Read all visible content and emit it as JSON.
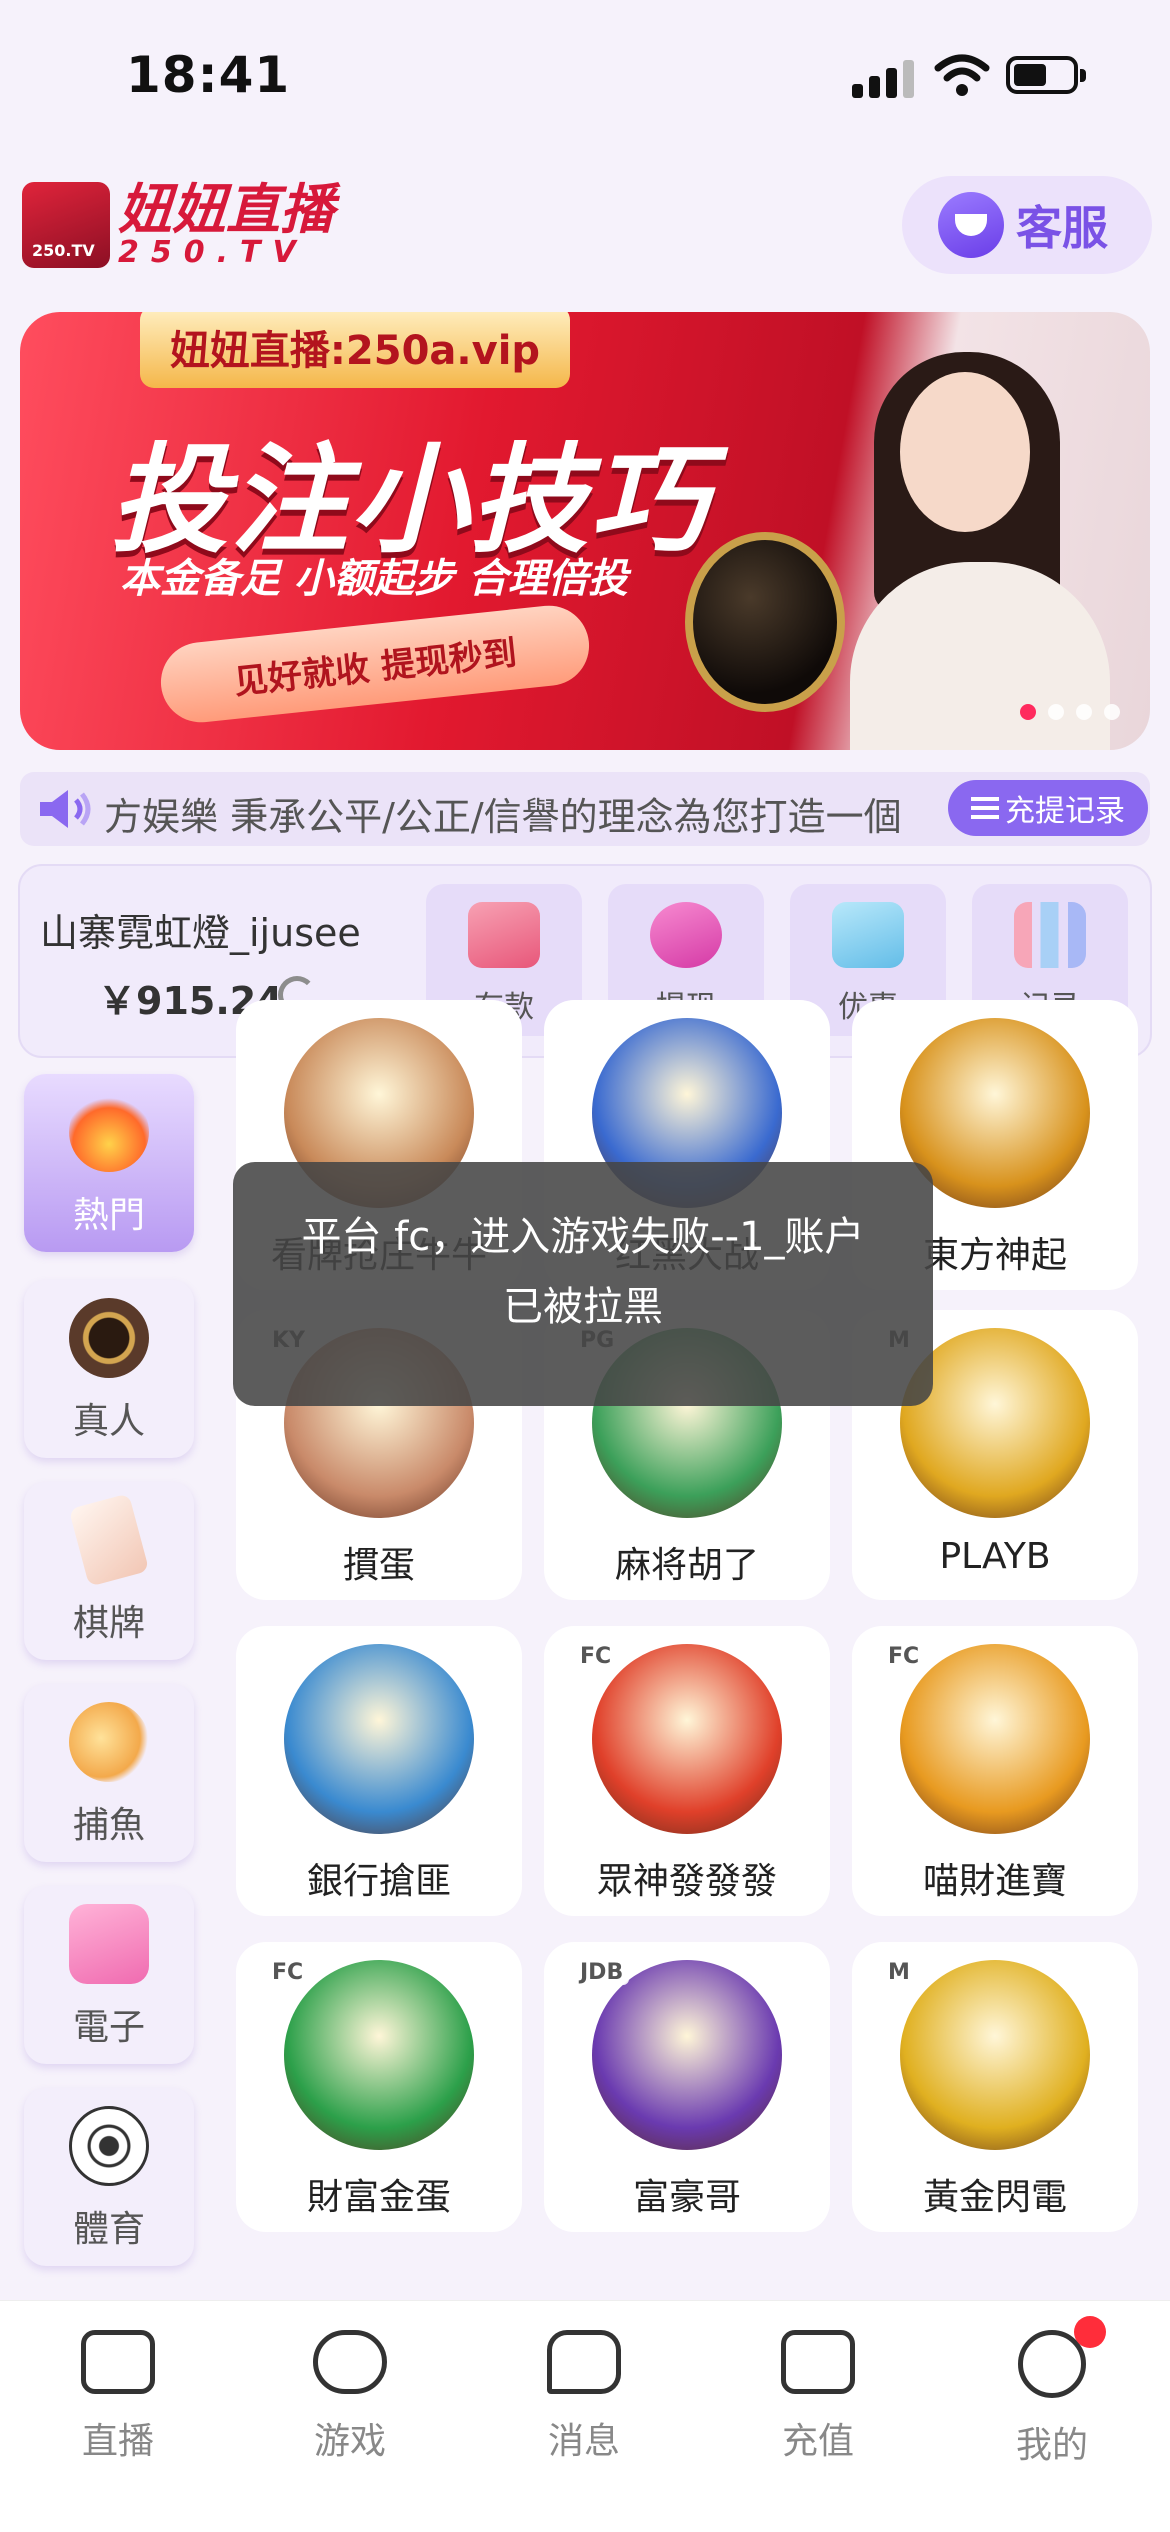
{
  "status_bar": {
    "time": "18:41"
  },
  "header": {
    "logo_title": "妞妞直播",
    "logo_domain": "250.TV",
    "logo_badge": "250.TV",
    "service_label": "客服"
  },
  "banner": {
    "domain": "妞妞直播:250a.vip",
    "headline": "投注小技巧",
    "subline": "本金备足 小额起步 合理倍投",
    "cta": "见好就收 提现秒到"
  },
  "marquee": {
    "text": "方娱樂 秉承公平/公正/信譽的理念為您打造一個",
    "record_button": "充提记录"
  },
  "user": {
    "name": "山寨霓虹燈_ijusee",
    "balance": "￥915.24"
  },
  "actions": [
    {
      "label": "存款",
      "icon": "wallet-cards-icon",
      "color": "#f7a1b3"
    },
    {
      "label": "提现",
      "icon": "money-bag-icon",
      "color": "#e64bb6"
    },
    {
      "label": "优惠",
      "icon": "gift-icon",
      "color": "#7fd0f2"
    },
    {
      "label": "记录",
      "icon": "bar-chart-icon",
      "color": "#9ec5f0"
    }
  ],
  "sidebar": [
    {
      "label": "熱門",
      "icon": "fire-icon",
      "color": "#ff6a2a",
      "active": true
    },
    {
      "label": "真人",
      "icon": "poker-chip-icon",
      "color": "#5a3a2a",
      "active": false
    },
    {
      "label": "棋牌",
      "icon": "playing-card-icon",
      "color": "#f2c7b5",
      "active": false
    },
    {
      "label": "捕魚",
      "icon": "fish-icon",
      "color": "#f3a94b",
      "active": false
    },
    {
      "label": "電子",
      "icon": "slot-machine-icon",
      "color": "#f06bb0",
      "active": false
    },
    {
      "label": "體育",
      "icon": "soccer-ball-icon",
      "color": "#333333",
      "active": false
    }
  ],
  "games": [
    {
      "name": "看牌抢庄牛牛",
      "tag": "",
      "color": "#c98a5a"
    },
    {
      "name": "红黑大战",
      "tag": "",
      "color": "#3a6ad0"
    },
    {
      "name": "東方神起",
      "tag": "",
      "color": "#d8921c"
    },
    {
      "name": "摜蛋",
      "tag": "KY",
      "color": "#c98a6a"
    },
    {
      "name": "麻将胡了",
      "tag": "PG",
      "color": "#3ca05a"
    },
    {
      "name": "PLAYB",
      "tag": "M",
      "color": "#e0a820"
    },
    {
      "name": "銀行搶匪",
      "tag": "",
      "color": "#3a8ad0"
    },
    {
      "name": "眾神發發發",
      "tag": "FC",
      "color": "#e0402a"
    },
    {
      "name": "喵財進寶",
      "tag": "FC",
      "color": "#e89a20"
    },
    {
      "name": "財富金蛋",
      "tag": "FC",
      "color": "#2ca04a"
    },
    {
      "name": "富豪哥",
      "tag": "JDB",
      "color": "#6a3ab0"
    },
    {
      "name": "黃金閃電",
      "tag": "M",
      "color": "#e0b020"
    }
  ],
  "toast": {
    "message": "平台 fc，进入游戏失败--1_账户已被拉黑"
  },
  "tabbar": [
    {
      "label": "直播",
      "icon": "video-camera-icon"
    },
    {
      "label": "游戏",
      "icon": "gamepad-icon"
    },
    {
      "label": "消息",
      "icon": "chat-bubble-icon"
    },
    {
      "label": "充值",
      "icon": "wallet-icon"
    },
    {
      "label": "我的",
      "icon": "profile-smile-icon"
    }
  ]
}
